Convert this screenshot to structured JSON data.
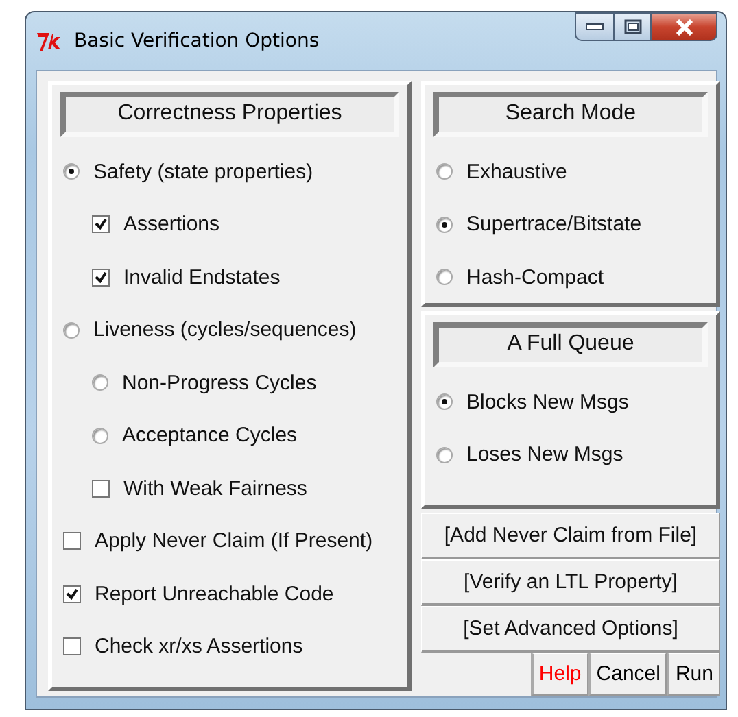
{
  "window": {
    "title": "Basic Verification Options"
  },
  "correctness": {
    "heading": "Correctness Properties",
    "options": [
      {
        "kind": "radio",
        "label": "Safety (state properties)",
        "selected": true,
        "children": [
          {
            "kind": "checkbox",
            "label": "Assertions",
            "checked": true
          },
          {
            "kind": "checkbox",
            "label": "Invalid Endstates",
            "checked": true
          }
        ]
      },
      {
        "kind": "radio",
        "label": "Liveness (cycles/sequences)",
        "selected": false,
        "children": [
          {
            "kind": "radio",
            "label": "Non-Progress Cycles",
            "selected": false
          },
          {
            "kind": "radio",
            "label": "Acceptance Cycles",
            "selected": false
          },
          {
            "kind": "checkbox",
            "label": "With Weak Fairness",
            "checked": false
          }
        ]
      },
      {
        "kind": "checkbox",
        "label": "Apply Never Claim (If Present)",
        "checked": false
      },
      {
        "kind": "checkbox",
        "label": "Report Unreachable Code",
        "checked": true
      },
      {
        "kind": "checkbox",
        "label": "Check xr/xs Assertions",
        "checked": false
      }
    ]
  },
  "search_mode": {
    "heading": "Search Mode",
    "options": [
      {
        "kind": "radio",
        "label": "Exhaustive",
        "selected": false
      },
      {
        "kind": "radio",
        "label": "Supertrace/Bitstate",
        "selected": true
      },
      {
        "kind": "radio",
        "label": "Hash-Compact",
        "selected": false
      }
    ]
  },
  "full_queue": {
    "heading": "A Full Queue",
    "options": [
      {
        "kind": "radio",
        "label": "Blocks New Msgs",
        "selected": true
      },
      {
        "kind": "radio",
        "label": "Loses New Msgs",
        "selected": false
      }
    ]
  },
  "actions": [
    {
      "label": "[Add Never Claim from File]"
    },
    {
      "label": "[Verify an LTL Property]"
    },
    {
      "label": "[Set Advanced Options]"
    }
  ],
  "buttons": [
    {
      "label": "Help",
      "color": "#ff0000"
    },
    {
      "label": "Cancel",
      "color": "#000000"
    },
    {
      "label": "Run",
      "color": "#000000"
    }
  ]
}
